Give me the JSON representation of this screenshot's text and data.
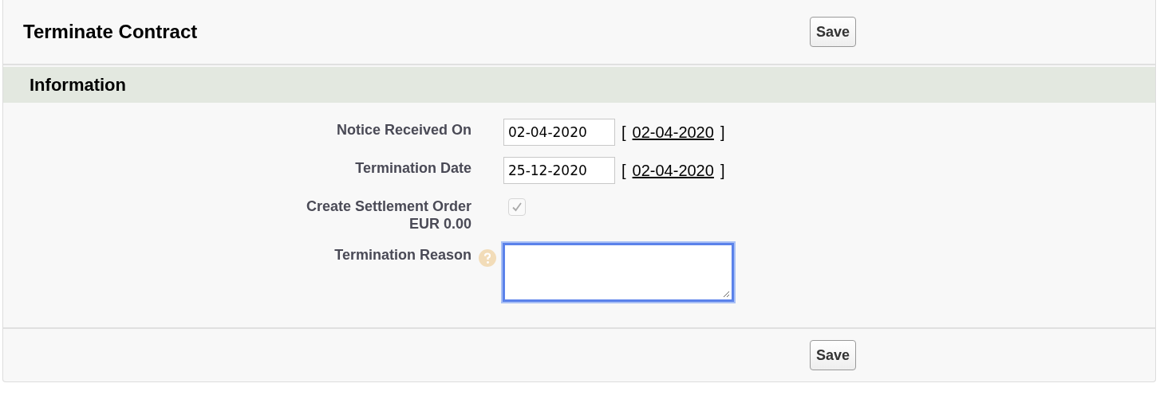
{
  "header": {
    "title": "Terminate Contract",
    "button": "Save"
  },
  "section": {
    "title": "Information"
  },
  "fields": [
    {
      "kind": "date",
      "label": "Notice Received On",
      "value": "02-04-2020",
      "open_bracket": "[",
      "today_link": "02-04-2020",
      "close_bracket": "]"
    },
    {
      "kind": "date",
      "label": "Termination Date",
      "value": "25-12-2020",
      "open_bracket": "[",
      "today_link": "02-04-2020",
      "close_bracket": "]"
    },
    {
      "kind": "checkbox",
      "label": "Create Settlement Order",
      "sublabel": "EUR 0.00",
      "checked": true,
      "disabled": true
    },
    {
      "kind": "textarea",
      "label": "Termination Reason",
      "help": true,
      "focused": true
    }
  ],
  "footer": {
    "button": "Save"
  }
}
